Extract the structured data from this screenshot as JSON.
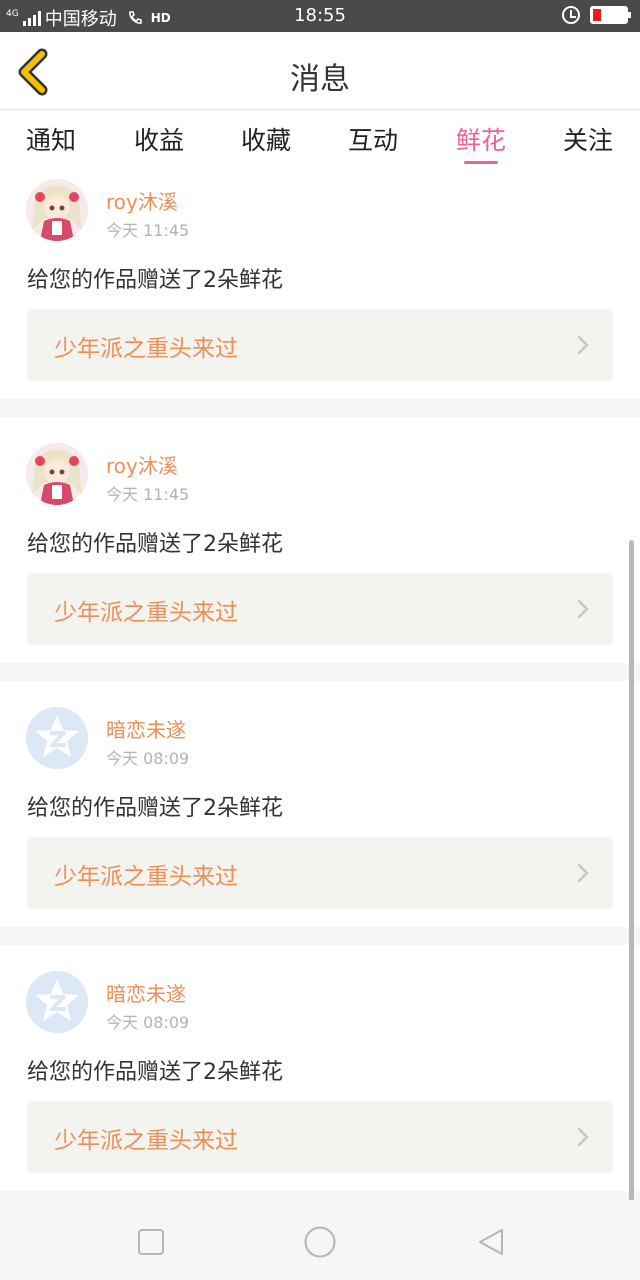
{
  "status_bar": {
    "network_tag": "4G",
    "carrier": "中国移动",
    "hd_badge": "HD",
    "time": "18:55",
    "icons": [
      "signal-icon",
      "call-icon",
      "alarm-icon",
      "battery-low-icon"
    ],
    "battery_color": "#e02020"
  },
  "header": {
    "title": "消息",
    "back_icon": "chevron-left-icon",
    "back_color": "#f2c200"
  },
  "tabs": [
    {
      "label": "通知"
    },
    {
      "label": "收益"
    },
    {
      "label": "收藏"
    },
    {
      "label": "互动"
    },
    {
      "label": "鲜花",
      "active": true
    },
    {
      "label": "关注"
    }
  ],
  "accent_color": "#f0609a",
  "name_color": "#ee8f55",
  "messages": [
    {
      "user": "roy沐溪",
      "time": "今天 11:45",
      "text": "给您的作品赠送了2朵鲜花",
      "work": "少年派之重头来过",
      "avatar": "anime-girl-avatar"
    },
    {
      "user": "roy沐溪",
      "time": "今天 11:45",
      "text": "给您的作品赠送了2朵鲜花",
      "work": "少年派之重头来过",
      "avatar": "anime-girl-avatar"
    },
    {
      "user": "暗恋未遂",
      "time": "今天 08:09",
      "text": "给您的作品赠送了2朵鲜花",
      "work": "少年派之重头来过",
      "avatar": "default-z-avatar"
    },
    {
      "user": "暗恋未遂",
      "time": "今天 08:09",
      "text": "给您的作品赠送了2朵鲜花",
      "work": "少年派之重头来过",
      "avatar": "default-z-avatar"
    }
  ],
  "nav_bar": {
    "buttons": [
      "recent-apps-icon",
      "home-icon",
      "back-icon"
    ]
  }
}
